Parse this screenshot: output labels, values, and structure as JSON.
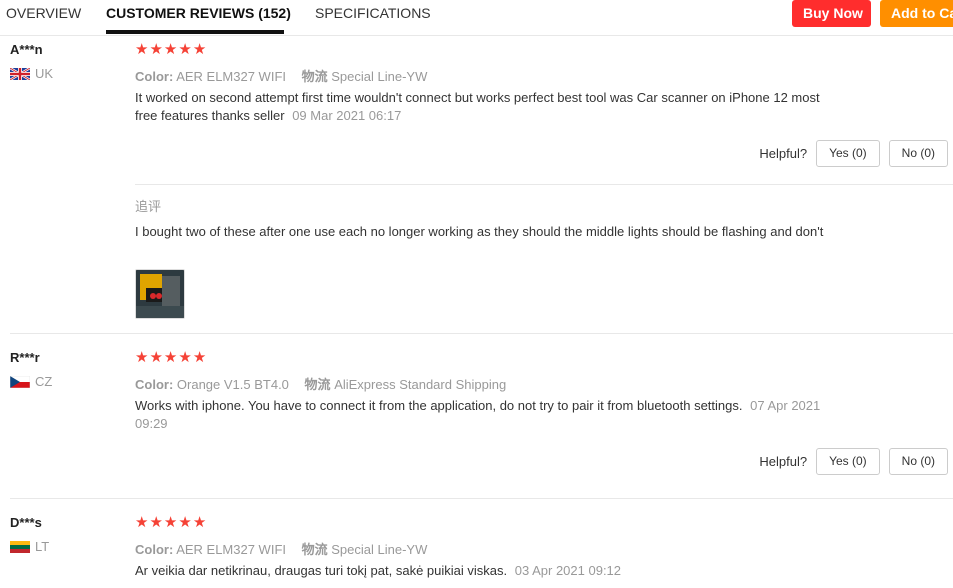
{
  "tabs": [
    "OVERVIEW",
    "CUSTOMER REVIEWS (152)",
    "SPECIFICATIONS"
  ],
  "buttons": {
    "buy_now": "Buy Now",
    "add_to_cart": "Add to Cart"
  },
  "colors": {
    "star": "#f54236",
    "buy_now": "#ff2d2d",
    "add_to_cart": "#ff8f00"
  },
  "helpful_label": "Helpful?",
  "color_label": "Color:",
  "shipping_label": "物流",
  "reviews": [
    {
      "user": "A***n",
      "country": "UK",
      "flag": "uk-flag",
      "stars": 5,
      "color": "AER ELM327 WIFI",
      "shipping": "Special Line-YW",
      "text": "It worked on second attempt first time wouldn't connect but works perfect best tool was Car scanner on iPhone 12 most free features thanks seller",
      "date": "09 Mar 2021 06:17",
      "yes": "Yes (0)",
      "no": "No (0)",
      "additional": {
        "title": "追评",
        "text": "I bought two of these after one use each no longer working as they should the middle lights should be flashing and don't"
      }
    },
    {
      "user": "R***r",
      "country": "CZ",
      "flag": "czech-flag",
      "stars": 5,
      "color": "Orange V1.5 BT4.0",
      "shipping": "AliExpress Standard Shipping",
      "text": "Works with iphone. You have to connect it from the application, do not try to pair it from bluetooth settings.",
      "date": "07 Apr 2021 09:29",
      "yes": "Yes (0)",
      "no": "No (0)"
    },
    {
      "user": "D***s",
      "country": "LT",
      "flag": "lithuania-flag",
      "stars": 5,
      "color": "AER ELM327 WIFI",
      "shipping": "Special Line-YW",
      "text": "Ar veikia dar netikrinau, draugas turi tokį pat, sakė puikiai viskas.",
      "date": "03 Apr 2021 09:12"
    }
  ]
}
